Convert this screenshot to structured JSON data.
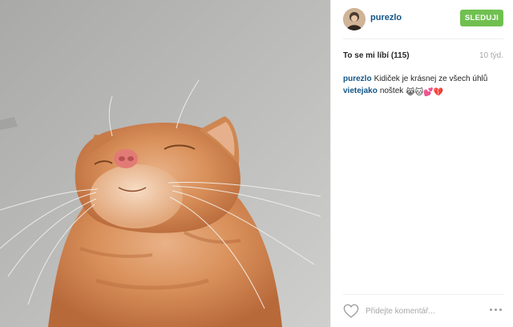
{
  "post": {
    "username": "purezlo",
    "follow_label": "SLEDUJI",
    "likes_text": "To se mi líbí (115)",
    "time_ago": "10 týd.",
    "photo_icon": "cat-photo",
    "comments": [
      {
        "user": "purezlo",
        "text": "Kidiček je krásnej ze všech úhlů",
        "emoji": ""
      },
      {
        "user": "vietejako",
        "text": "noštek",
        "emoji": "😹🐱💕💔"
      }
    ],
    "comment_placeholder": "Přidejte komentář...",
    "icons": {
      "like": "heart-outline-icon",
      "more": "ellipsis-icon"
    }
  },
  "colors": {
    "username": "#125688",
    "follow_button": "#70c050",
    "muted": "#a5a7aa",
    "divider": "#efefef"
  }
}
